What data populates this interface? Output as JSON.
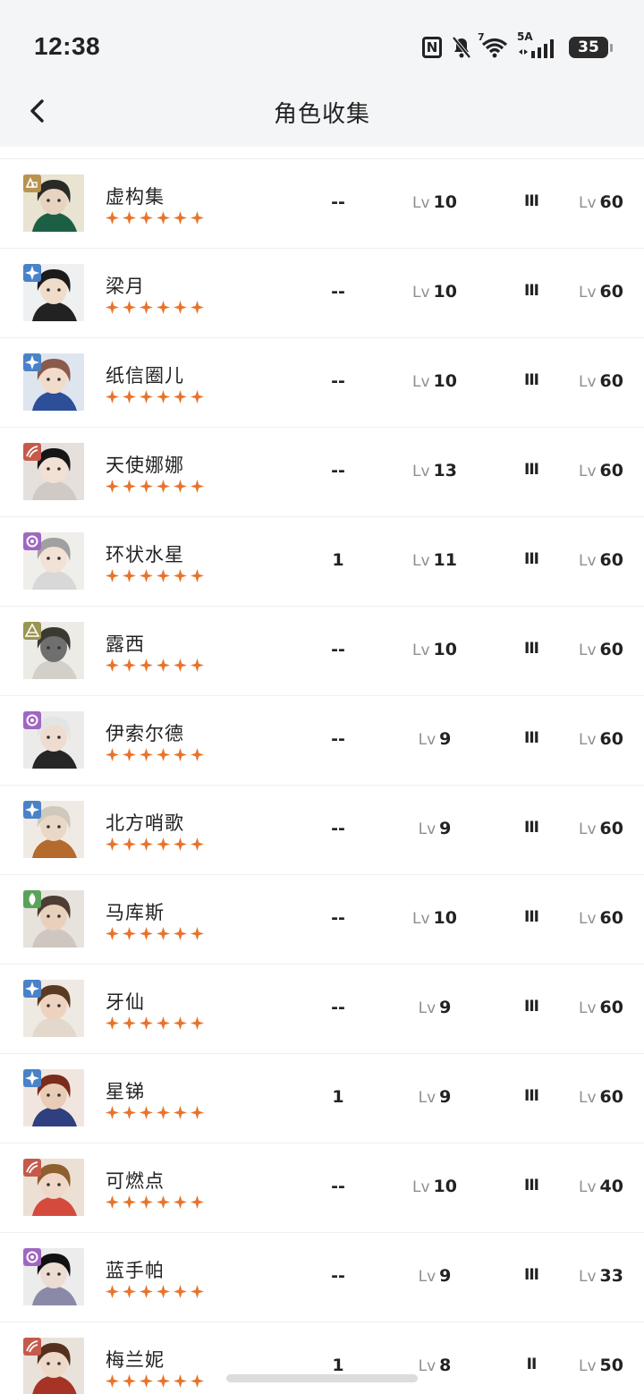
{
  "status_bar": {
    "time": "12:38",
    "network_label": "5A",
    "battery": "35",
    "wifi_label": "7"
  },
  "nav": {
    "title": "角色收集"
  },
  "characters": [
    {
      "name": "虚构集",
      "awaken": "--",
      "lv_prefix": "Lv",
      "level": "10",
      "rank": "III",
      "max_prefix": "Lv",
      "max_level": "60",
      "element": "gold",
      "stars": 6
    },
    {
      "name": "梁月",
      "awaken": "--",
      "lv_prefix": "Lv",
      "level": "10",
      "rank": "III",
      "max_prefix": "Lv",
      "max_level": "60",
      "element": "blue",
      "stars": 6
    },
    {
      "name": "纸信圈儿",
      "awaken": "--",
      "lv_prefix": "Lv",
      "level": "10",
      "rank": "III",
      "max_prefix": "Lv",
      "max_level": "60",
      "element": "blue",
      "stars": 6
    },
    {
      "name": "天使娜娜",
      "awaken": "--",
      "lv_prefix": "Lv",
      "level": "13",
      "rank": "III",
      "max_prefix": "Lv",
      "max_level": "60",
      "element": "red",
      "stars": 6
    },
    {
      "name": "环状水星",
      "awaken": "1",
      "lv_prefix": "Lv",
      "level": "11",
      "rank": "III",
      "max_prefix": "Lv",
      "max_level": "60",
      "element": "purple",
      "stars": 6
    },
    {
      "name": "露西",
      "awaken": "--",
      "lv_prefix": "Lv",
      "level": "10",
      "rank": "III",
      "max_prefix": "Lv",
      "max_level": "60",
      "element": "olive",
      "stars": 6
    },
    {
      "name": "伊索尔德",
      "awaken": "--",
      "lv_prefix": "Lv",
      "level": "9",
      "rank": "III",
      "max_prefix": "Lv",
      "max_level": "60",
      "element": "purple",
      "stars": 6
    },
    {
      "name": "北方哨歌",
      "awaken": "--",
      "lv_prefix": "Lv",
      "level": "9",
      "rank": "III",
      "max_prefix": "Lv",
      "max_level": "60",
      "element": "blue",
      "stars": 6
    },
    {
      "name": "马库斯",
      "awaken": "--",
      "lv_prefix": "Lv",
      "level": "10",
      "rank": "III",
      "max_prefix": "Lv",
      "max_level": "60",
      "element": "green",
      "stars": 6
    },
    {
      "name": "牙仙",
      "awaken": "--",
      "lv_prefix": "Lv",
      "level": "9",
      "rank": "III",
      "max_prefix": "Lv",
      "max_level": "60",
      "element": "blue",
      "stars": 6
    },
    {
      "name": "星锑",
      "awaken": "1",
      "lv_prefix": "Lv",
      "level": "9",
      "rank": "III",
      "max_prefix": "Lv",
      "max_level": "60",
      "element": "blue",
      "stars": 6
    },
    {
      "name": "可燃点",
      "awaken": "--",
      "lv_prefix": "Lv",
      "level": "10",
      "rank": "III",
      "max_prefix": "Lv",
      "max_level": "40",
      "element": "red",
      "stars": 6
    },
    {
      "name": "蓝手帕",
      "awaken": "--",
      "lv_prefix": "Lv",
      "level": "9",
      "rank": "III",
      "max_prefix": "Lv",
      "max_level": "33",
      "element": "purple",
      "stars": 6
    },
    {
      "name": "梅兰妮",
      "awaken": "1",
      "lv_prefix": "Lv",
      "level": "8",
      "rank": "II",
      "max_prefix": "Lv",
      "max_level": "50",
      "element": "red",
      "stars": 6
    }
  ],
  "element_colors": {
    "gold": "#b89350",
    "blue": "#4a82c8",
    "red": "#c55a4c",
    "purple": "#a067c2",
    "olive": "#9a9550",
    "green": "#5aa35a"
  },
  "star_color": "#e8742c",
  "portrait_palettes": [
    [
      "#e9e3d2",
      "#2a2a26",
      "#e8d2c0",
      "#1d5f44"
    ],
    [
      "#eef0f2",
      "#1b1b1b",
      "#f0dccb",
      "#222222"
    ],
    [
      "#dfe5ef",
      "#8b5a4a",
      "#f1dccb",
      "#2d4f9a"
    ],
    [
      "#e6e0dc",
      "#161616",
      "#f3e0d4",
      "#cfcac5"
    ],
    [
      "#f0eeeb",
      "#a0a0a0",
      "#f2e2d6",
      "#d8d8d8"
    ],
    [
      "#ecebe6",
      "#3a3a32",
      "#6f6f6f",
      "#d2d0c8"
    ],
    [
      "#ecebea",
      "#e4e4e4",
      "#eedcd0",
      "#262626"
    ],
    [
      "#efebe4",
      "#cfc8bc",
      "#e9d8c6",
      "#b56a2e"
    ],
    [
      "#e7e2dc",
      "#4c3e34",
      "#e8d0bd",
      "#cfc7bf"
    ],
    [
      "#efe9e3",
      "#5b3a22",
      "#edd3bf",
      "#e2d8cc"
    ],
    [
      "#f1e6df",
      "#7a2b1a",
      "#e9ccb6",
      "#2f3f7f"
    ],
    [
      "#ece0d5",
      "#8e5f2f",
      "#f0d8c8",
      "#d44b3e"
    ],
    [
      "#edecec",
      "#121212",
      "#ecdcd2",
      "#8a8aa8"
    ],
    [
      "#e9e2da",
      "#55301f",
      "#eed8c7",
      "#a53426"
    ]
  ]
}
